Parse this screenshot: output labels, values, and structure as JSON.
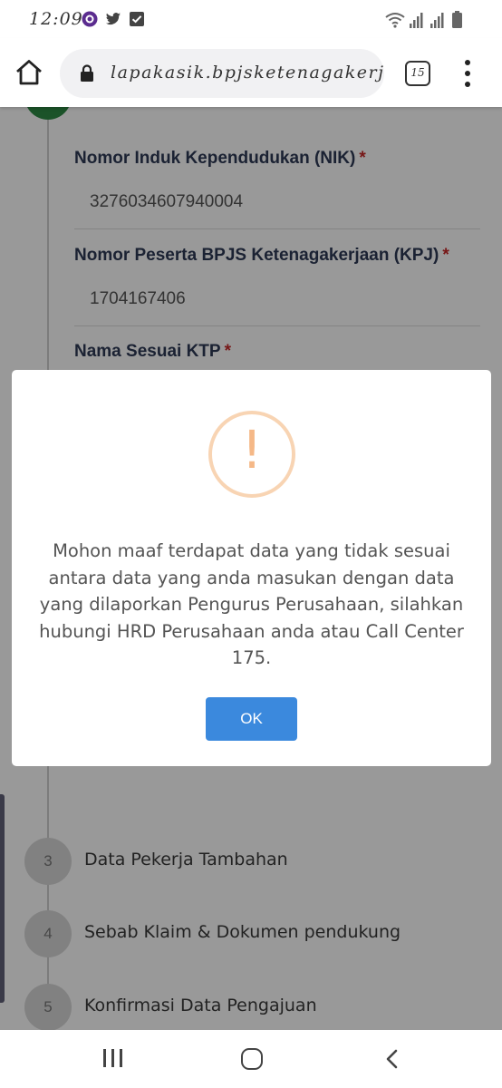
{
  "status_bar": {
    "time": "12:09",
    "icons_left": [
      "circle-app-icon",
      "twitter-icon",
      "check-box-icon"
    ],
    "icons_right": [
      "wifi-icon",
      "signal-icon",
      "signal-icon",
      "battery-icon"
    ]
  },
  "browser": {
    "url": "lapakasik.bpjsketenagakerjaan.go.id",
    "tab_count": "15"
  },
  "form": {
    "fields": [
      {
        "label": "Nomor Induk Kependudukan (NIK)",
        "required_mark": "*",
        "value": "3276034607940004"
      },
      {
        "label": "Nomor Peserta BPJS Ketenagakerjaan (KPJ)",
        "required_mark": "*",
        "value": "1704167406"
      },
      {
        "label": "Nama Sesuai KTP",
        "required_mark": "*"
      }
    ],
    "steps": [
      {
        "number": "3",
        "label": "Data Pekerja Tambahan"
      },
      {
        "number": "4",
        "label": "Sebab Klaim & Dokumen pendukung"
      },
      {
        "number": "5",
        "label": "Konfirmasi Data Pengajuan"
      }
    ]
  },
  "dialog": {
    "icon": "warning-icon",
    "icon_symbol": "!",
    "message": "Mohon maaf terdapat data yang tidak sesuai antara data yang anda masukan dengan data yang dilaporkan Pengurus Perusahaan, silahkan hubungi HRD Perusahaan anda atau Call Center 175.",
    "ok_label": "OK"
  },
  "colors": {
    "accent_green": "#2e8a45",
    "ok_button": "#3b89dd",
    "warning_orange": "#f5b887",
    "required_red": "#c62828"
  }
}
